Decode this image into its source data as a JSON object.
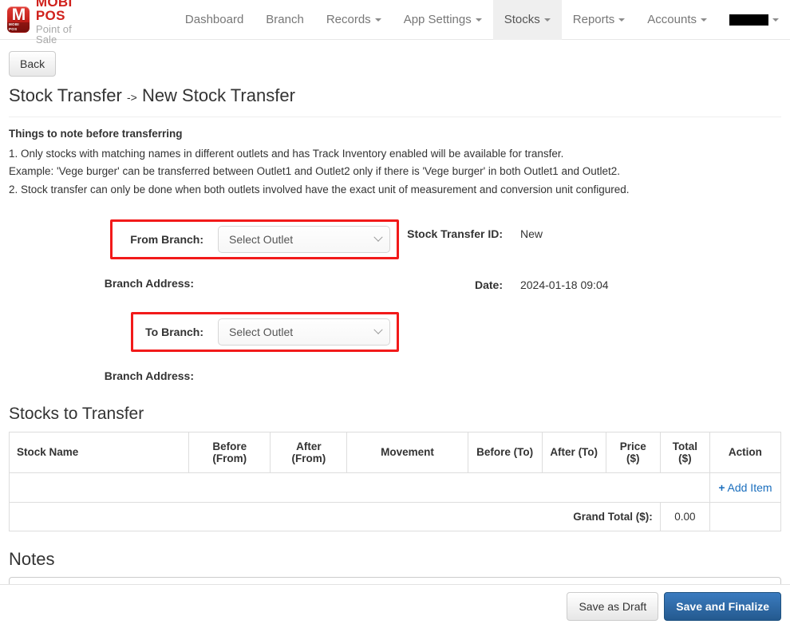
{
  "brand": {
    "logo_glyph": "M",
    "logo_sub": "MOBI POS",
    "title": "MOBI POS",
    "subtitle": "Point of Sale",
    "accent_color": "#d0211c"
  },
  "nav": {
    "items": [
      {
        "label": "Dashboard",
        "has_caret": false,
        "active": false
      },
      {
        "label": "Branch",
        "has_caret": false,
        "active": false
      },
      {
        "label": "Records",
        "has_caret": true,
        "active": false
      },
      {
        "label": "App Settings",
        "has_caret": true,
        "active": false
      },
      {
        "label": "Stocks",
        "has_caret": true,
        "active": true
      },
      {
        "label": "Reports",
        "has_caret": true,
        "active": false
      },
      {
        "label": "Accounts",
        "has_caret": true,
        "active": false
      }
    ],
    "account_redacted": true
  },
  "toolbar": {
    "back_label": "Back"
  },
  "page": {
    "breadcrumb_root": "Stock Transfer",
    "breadcrumb_arrow": "->",
    "breadcrumb_current": "New Stock Transfer"
  },
  "notice": {
    "heading": "Things to note before transferring",
    "lines": [
      "1. Only stocks with matching names in different outlets and has Track Inventory enabled will be available for transfer.",
      "Example: 'Vege burger' can be transferred between Outlet1 and Outlet2 only if there is 'Vege burger' in both Outlet1 and Outlet2.",
      "2. Stock transfer can only be done when both outlets involved have the exact unit of measurement and conversion unit configured."
    ]
  },
  "form": {
    "from_branch_label": "From Branch:",
    "from_branch_value": "Select Outlet",
    "from_address_label": "Branch Address:",
    "from_address_value": "",
    "to_branch_label": "To Branch:",
    "to_branch_value": "Select Outlet",
    "to_address_label": "Branch Address:",
    "to_address_value": "",
    "transfer_id_label": "Stock Transfer ID:",
    "transfer_id_value": "New",
    "date_label": "Date:",
    "date_value": "2024-01-18 09:04",
    "highlight_color": "#f21a1a"
  },
  "stocks": {
    "section_title": "Stocks to Transfer",
    "columns": [
      "Stock Name",
      "Before (From)",
      "After (From)",
      "Movement",
      "Before (To)",
      "After (To)",
      "Price ($)",
      "Total ($)",
      "Action"
    ],
    "rows": [],
    "add_item_label": "Add Item",
    "add_item_icon": "+",
    "grand_total_label": "Grand Total ($):",
    "grand_total_value": "0.00"
  },
  "notes": {
    "title": "Notes",
    "value": "",
    "placeholder": ""
  },
  "footer": {
    "save_draft_label": "Save as Draft",
    "save_finalize_label": "Save and Finalize",
    "primary_color": "#2a6496"
  }
}
